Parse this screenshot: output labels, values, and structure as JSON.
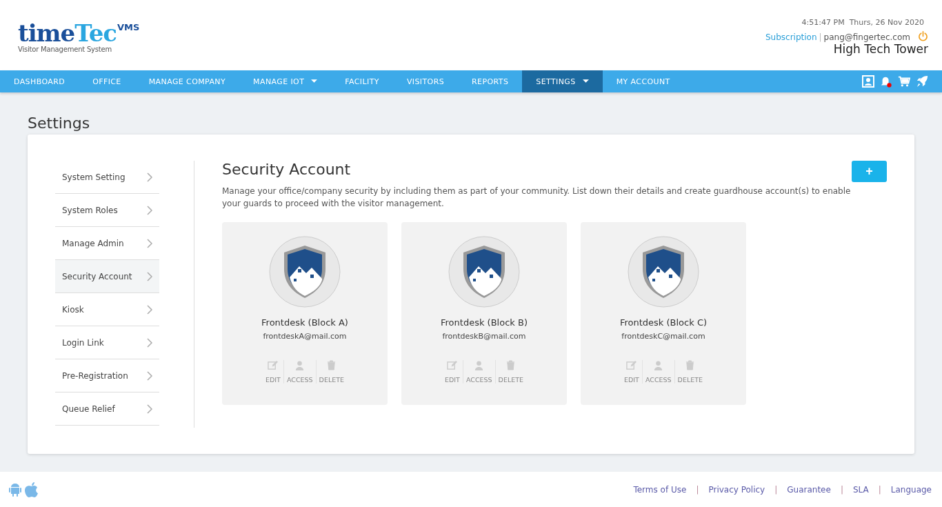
{
  "logo": {
    "word_a": "time",
    "word_b": "Tec",
    "badge": "VMS",
    "tagline": "Visitor Management System"
  },
  "header": {
    "datetime": "4:51:47 PM  Thurs, 26 Nov 2020",
    "subscription": "Subscription",
    "separator": "|",
    "email": "pang@fingertec.com",
    "building": "High Tech Tower"
  },
  "nav": [
    {
      "label": "DASHBOARD",
      "selected": false,
      "dropdown": false
    },
    {
      "label": "OFFICE",
      "selected": false,
      "dropdown": false
    },
    {
      "label": "MANAGE COMPANY",
      "selected": false,
      "dropdown": false
    },
    {
      "label": "MANAGE IOT",
      "selected": false,
      "dropdown": true
    },
    {
      "label": "FACILITY",
      "selected": false,
      "dropdown": false
    },
    {
      "label": "VISITORS",
      "selected": false,
      "dropdown": false
    },
    {
      "label": "REPORTS",
      "selected": false,
      "dropdown": false
    },
    {
      "label": "SETTINGS",
      "selected": true,
      "dropdown": true
    },
    {
      "label": "MY ACCOUNT",
      "selected": false,
      "dropdown": false
    }
  ],
  "page_title": "Settings",
  "sidebar": [
    {
      "label": "System Setting",
      "selected": false
    },
    {
      "label": "System Roles",
      "selected": false
    },
    {
      "label": "Manage Admin",
      "selected": false
    },
    {
      "label": "Security Account",
      "selected": true
    },
    {
      "label": "Kiosk",
      "selected": false
    },
    {
      "label": "Login Link",
      "selected": false
    },
    {
      "label": "Pre-Registration",
      "selected": false
    },
    {
      "label": "Queue Relief",
      "selected": false
    }
  ],
  "section": {
    "title": "Security Account",
    "add_button": "+",
    "description": "Manage your office/company security by including them as part of your community. List down their details and create guardhouse account(s) to enable your guards to proceed with the visitor management."
  },
  "cards": [
    {
      "name": "Frontdesk (Block A)",
      "email": "frontdeskA@mail.com",
      "actions": [
        "EDIT",
        "ACCESS",
        "DELETE"
      ]
    },
    {
      "name": "Frontdesk (Block B)",
      "email": "frontdeskB@mail.com",
      "actions": [
        "EDIT",
        "ACCESS",
        "DELETE"
      ]
    },
    {
      "name": "Frontdesk (Block C)",
      "email": "frontdeskC@mail.com",
      "actions": [
        "EDIT",
        "ACCESS",
        "DELETE"
      ]
    }
  ],
  "footer": {
    "links": [
      "Terms of Use",
      "Privacy Policy",
      "Guarantee",
      "SLA",
      "Language"
    ],
    "separator": "|"
  }
}
